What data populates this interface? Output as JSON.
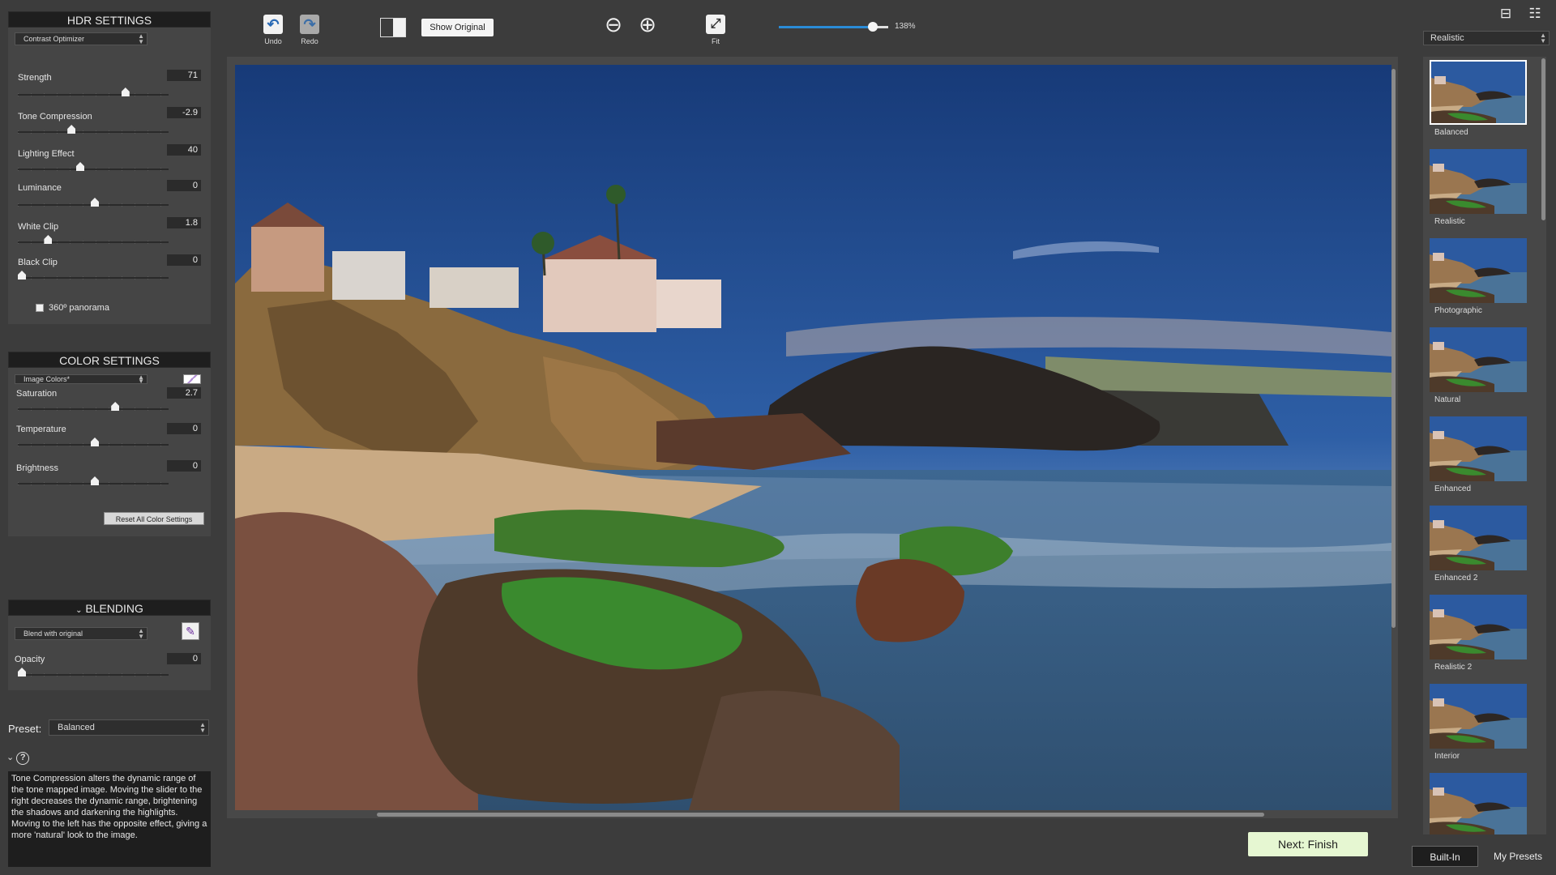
{
  "hdr": {
    "title": "HDR SETTINGS",
    "method": "Contrast Optimizer",
    "controls": [
      {
        "label": "Strength",
        "value": "71",
        "pos": 0.71
      },
      {
        "label": "Tone Compression",
        "value": "-2.9",
        "pos": 0.34
      },
      {
        "label": "Lighting Effect",
        "value": "40",
        "pos": 0.4
      },
      {
        "label": "Luminance",
        "value": "0",
        "pos": 0.5
      },
      {
        "label": "White Clip",
        "value": "1.8",
        "pos": 0.18
      },
      {
        "label": "Black Clip",
        "value": "0",
        "pos": 0.0
      }
    ],
    "panorama_label": "360º panorama"
  },
  "color": {
    "title": "COLOR SETTINGS",
    "mode": "Image Colors*",
    "controls": [
      {
        "label": "Saturation",
        "value": "2.7",
        "pos": 0.64
      },
      {
        "label": "Temperature",
        "value": "0",
        "pos": 0.5
      },
      {
        "label": "Brightness",
        "value": "0",
        "pos": 0.5
      }
    ],
    "reset_label": "Reset All Color Settings"
  },
  "blending": {
    "title": "BLENDING",
    "mode": "Blend with original",
    "controls": [
      {
        "label": "Opacity",
        "value": "0",
        "pos": 0.0
      }
    ]
  },
  "preset": {
    "label": "Preset:",
    "value": "Balanced"
  },
  "help": {
    "icon": "?",
    "text": "Tone Compression alters the dynamic range of the tone mapped image. Moving the slider to the right decreases the dynamic range, brightening the shadows and darkening the highlights. Moving to the left has the opposite effect, giving a more 'natural' look to the image."
  },
  "toolbar": {
    "undo": "Undo",
    "redo": "Redo",
    "show_original": "Show Original",
    "fit": "Fit",
    "zoom_value": "138%",
    "zoom_pos": 0.86
  },
  "next_label": "Next: Finish",
  "presets_panel": {
    "category": "Realistic",
    "items": [
      "Balanced",
      "Realistic",
      "Photographic",
      "Natural",
      "Enhanced",
      "Enhanced 2",
      "Realistic 2",
      "Interior",
      ""
    ],
    "tabs": [
      "Built-In",
      "My Presets"
    ]
  },
  "colors": {
    "panel_bg": "#454545",
    "header_bg": "#1e1e1e",
    "accent": "#2a8bd6",
    "next_bg": "#e6f7d2"
  }
}
